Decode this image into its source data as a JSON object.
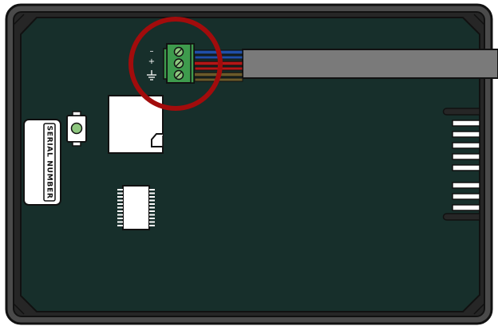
{
  "device": {
    "serial_label": "SERIAL NUMBER",
    "terminal_symbols": {
      "minus": "–",
      "plus": "+"
    },
    "colors": {
      "enclosure": "#4a4a4a",
      "enclosure_inner_frame": "#262626",
      "board": "#172f2b",
      "terminal_block": "#3e9b4d",
      "screw": "#8ec77f",
      "highlight_ring": "#a20c0c",
      "cable": "#7a7a7a",
      "wire_negative": "#1f4fa8",
      "wire_positive": "#b41616",
      "wire_ground": "#6b5a2a",
      "component_white": "#ffffff"
    },
    "icons": {
      "ground": "ground-icon",
      "button": "push-button-icon"
    }
  }
}
